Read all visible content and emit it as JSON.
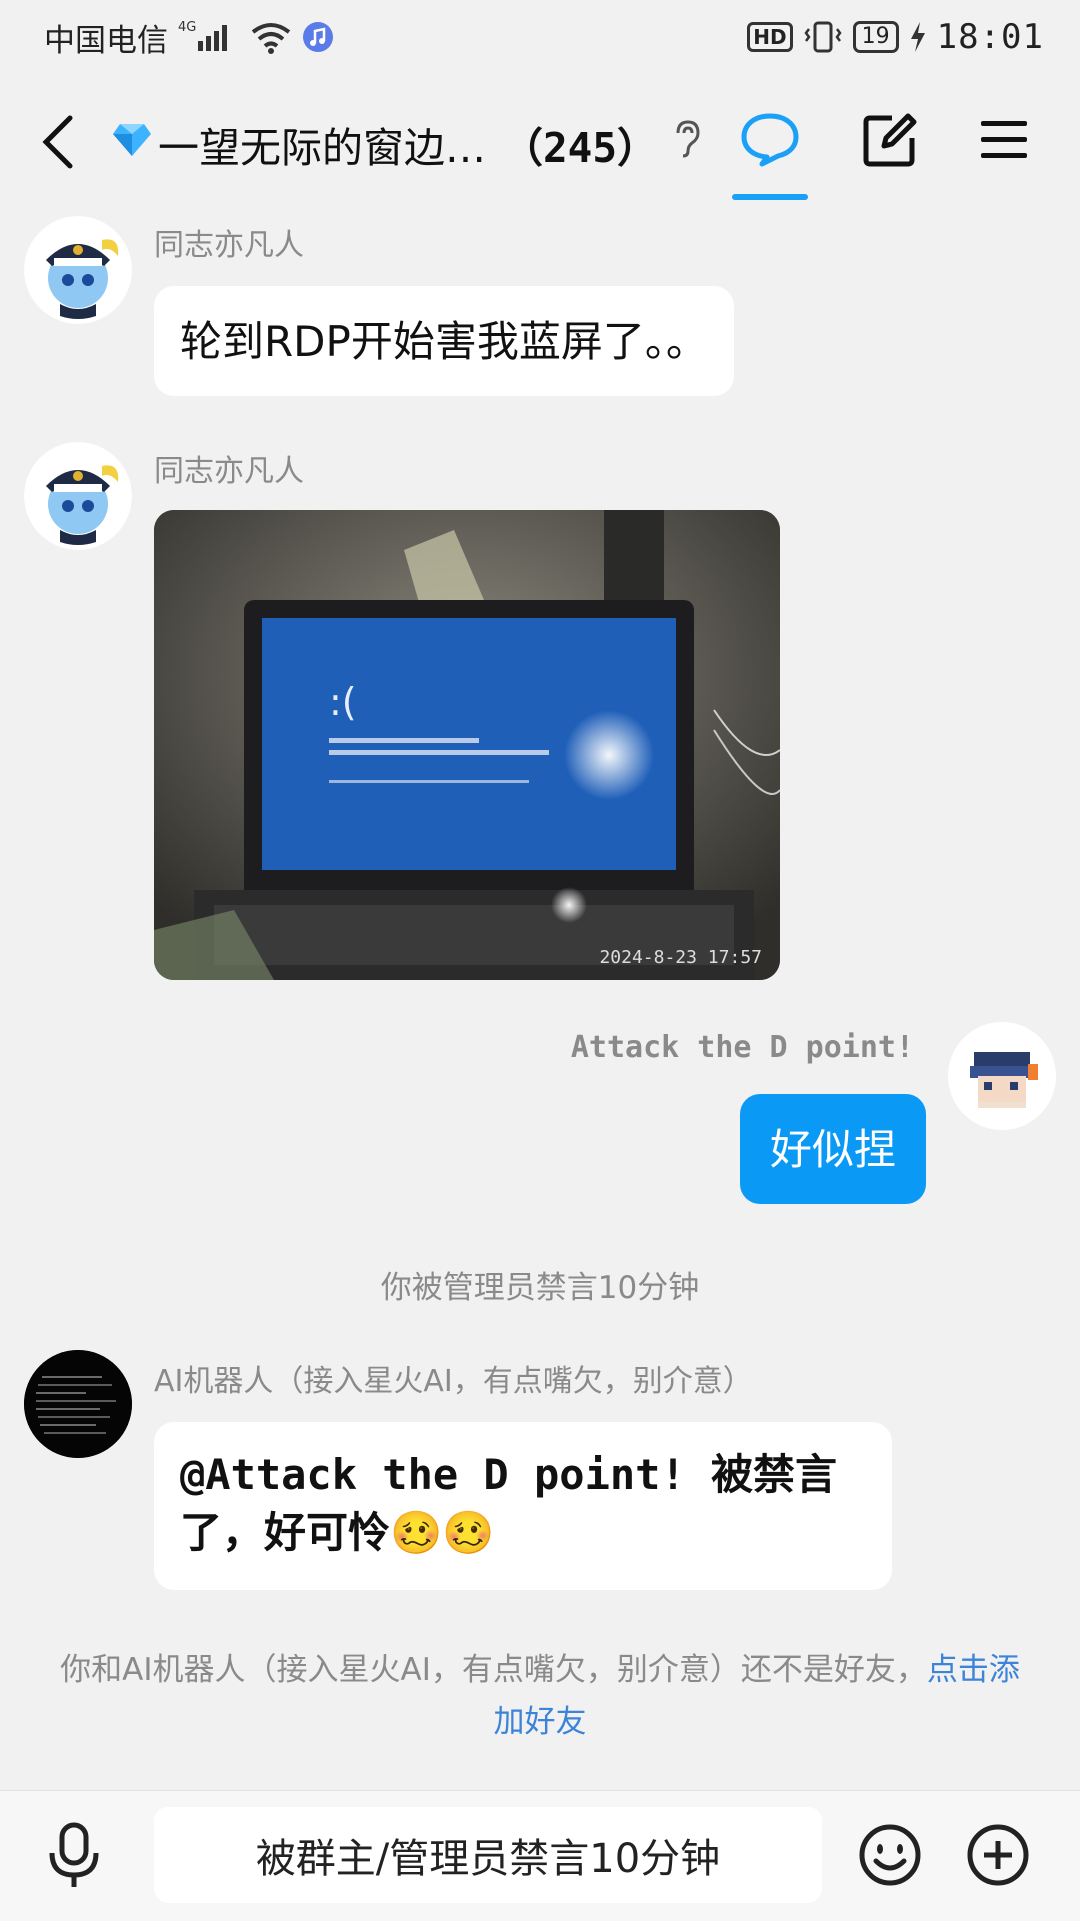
{
  "status_bar": {
    "carrier": "中国电信",
    "network": "4G",
    "hd": "HD",
    "battery": "19",
    "time": "18:01"
  },
  "header": {
    "title": "一望无际的窗边…",
    "member_count": "（245）"
  },
  "messages": [
    {
      "sender": "同志亦凡人",
      "text": "轮到RDP开始害我蓝屏了。。"
    },
    {
      "sender": "同志亦凡人",
      "image_caption_timestamp": "2024-8-23 17:57"
    },
    {
      "sender": "Attack the D point!",
      "text": "好似捏"
    }
  ],
  "system_notice": "你被管理员禁言10分钟",
  "bot_message": {
    "sender": "AI机器人（接入星火AI，有点嘴欠，别介意）",
    "text": "@Attack the D point! 被禁言了，好可怜🥴🥴"
  },
  "friend_notice": {
    "text": "你和AI机器人（接入星火AI，有点嘴欠，别介意）还不是好友，",
    "link": "点击添加好友"
  },
  "input": {
    "muted_text": "被群主/管理员禁言10分钟"
  },
  "colors": {
    "accent": "#0a99f5",
    "link": "#3d84d9",
    "background": "#f1f1f1"
  }
}
